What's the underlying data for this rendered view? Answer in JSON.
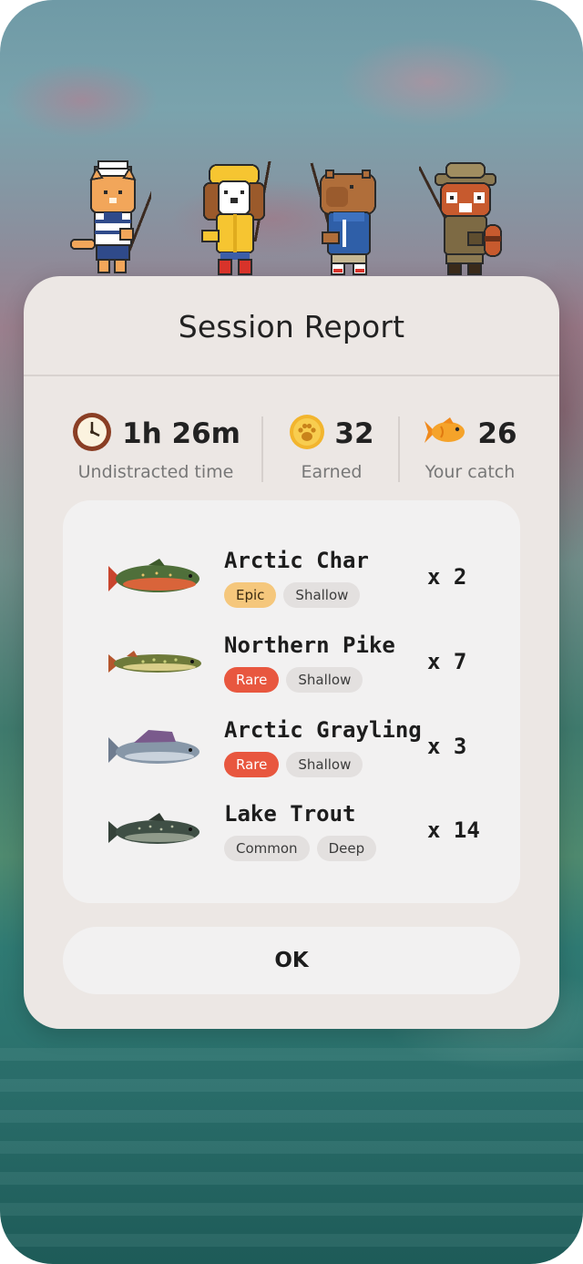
{
  "dialog": {
    "title": "Session Report"
  },
  "stats": [
    {
      "icon": "clock-icon",
      "value": "1h 26m",
      "label": "Undistracted time"
    },
    {
      "icon": "paw-coin-icon",
      "value": "32",
      "label": "Earned"
    },
    {
      "icon": "goldfish-icon",
      "value": "26",
      "label": "Your catch"
    }
  ],
  "catch": [
    {
      "name": "Arctic Char",
      "rarity": "Epic",
      "depth": "Shallow",
      "quantity": "x 2"
    },
    {
      "name": "Northern Pike",
      "rarity": "Rare",
      "depth": "Shallow",
      "quantity": "x 7"
    },
    {
      "name": "Arctic Grayling",
      "rarity": "Rare",
      "depth": "Shallow",
      "quantity": "x 3"
    },
    {
      "name": "Lake Trout",
      "rarity": "Common",
      "depth": "Deep",
      "quantity": "x 14"
    }
  ],
  "ok_button": {
    "label": "OK"
  },
  "characters": [
    "cat-sailor",
    "dog-raincoat",
    "capybara-hoodie",
    "red-panda-explorer"
  ],
  "colors": {
    "card": "#ece7e4",
    "panel": "#f2f1f1",
    "epic": "#f5c77c",
    "rare": "#e8573f",
    "common": "#e3e0df"
  }
}
